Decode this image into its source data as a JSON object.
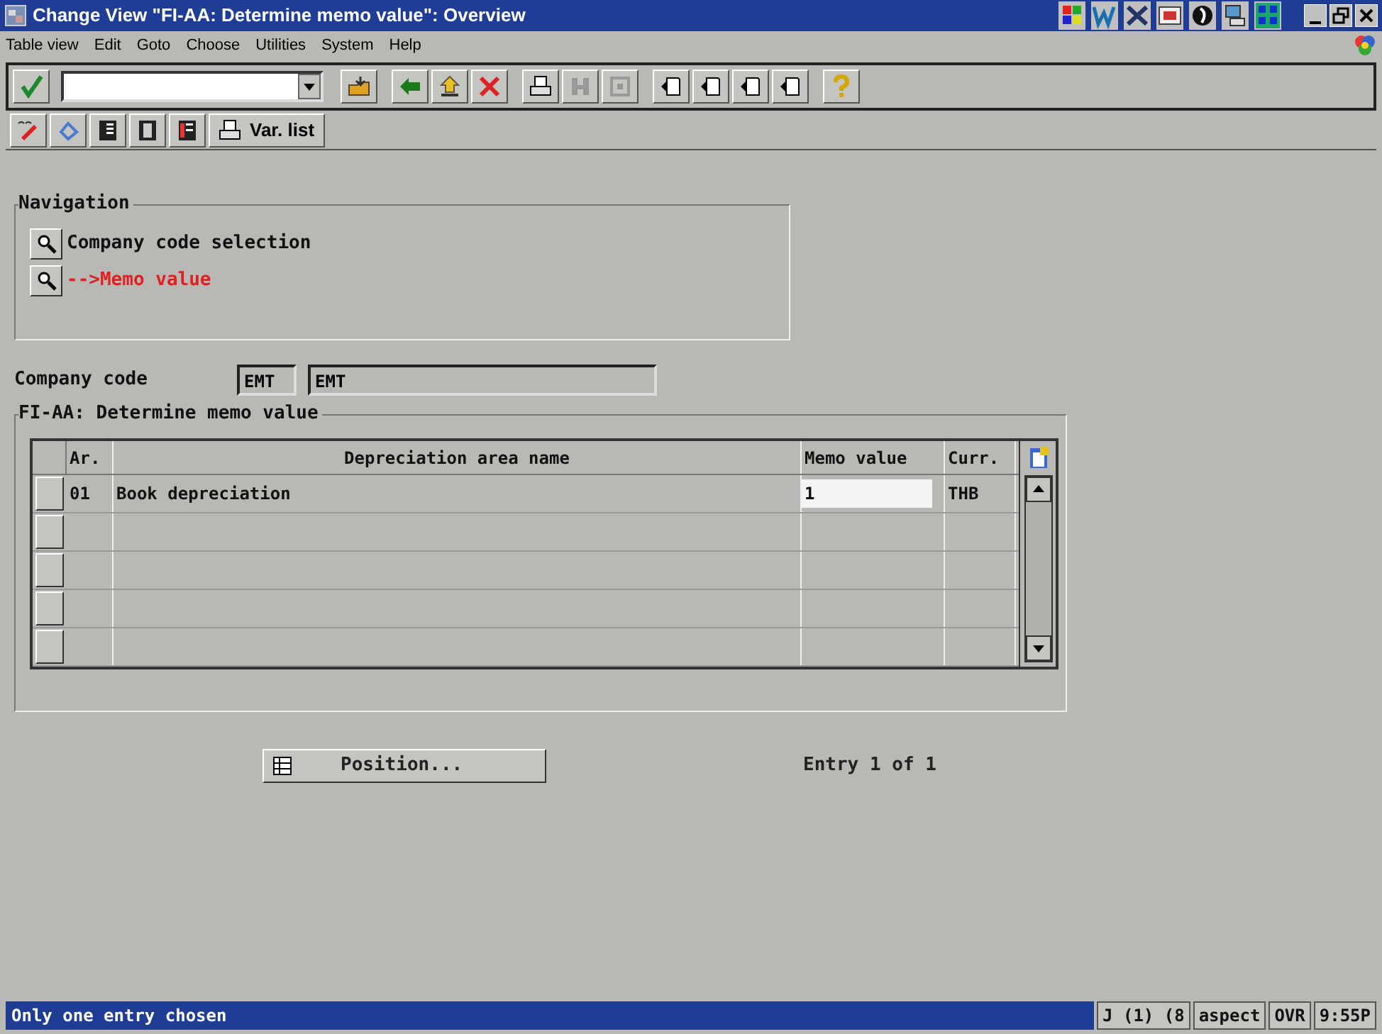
{
  "window": {
    "title": "Change View \"FI-AA: Determine memo value\": Overview"
  },
  "menu": [
    "Table view",
    "Edit",
    "Goto",
    "Choose",
    "Utilities",
    "System",
    "Help"
  ],
  "application_toolbar": {
    "button_label": "Var. list"
  },
  "navigation": {
    "title": "Navigation",
    "items": [
      {
        "label": "Company code selection",
        "selected": false
      },
      {
        "label": "-->Memo value",
        "selected": true
      }
    ]
  },
  "company_code": {
    "label": "Company code",
    "value": "EMT",
    "name": "EMT"
  },
  "group": {
    "title": "FI-AA: Determine memo value"
  },
  "table": {
    "columns": [
      "Ar.",
      "Depreciation area name",
      "Memo value",
      "Curr."
    ],
    "rows": [
      {
        "area": "01",
        "name": "Book depreciation",
        "memo_value": "1",
        "currency": "THB"
      }
    ]
  },
  "position_button": "Position...",
  "entry_info": "Entry 1 of 1",
  "status_bar": {
    "message": "Only one entry chosen",
    "segments": [
      "J (1) (8",
      "aspect",
      "OVR",
      "9:55P"
    ]
  }
}
